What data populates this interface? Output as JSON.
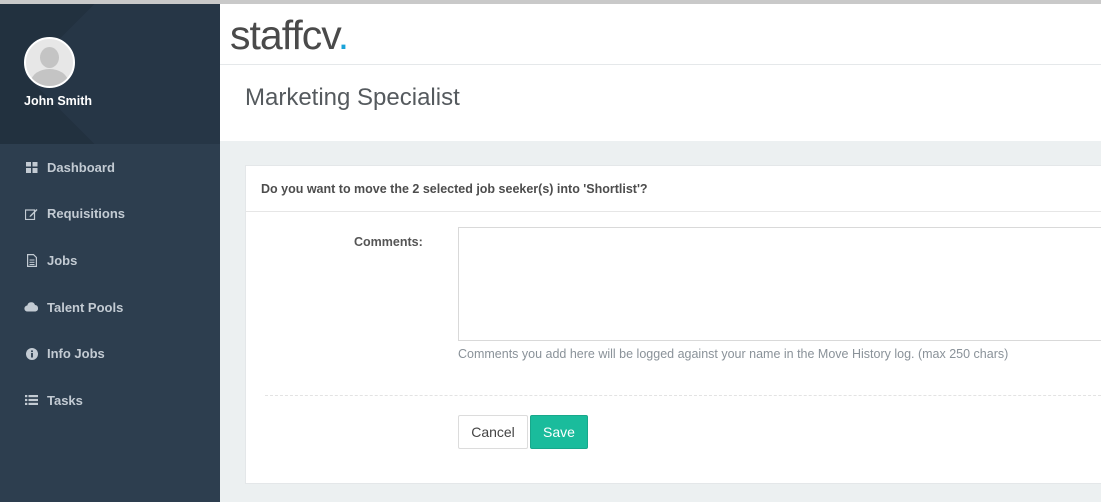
{
  "user": {
    "name": "John Smith"
  },
  "sidebar": {
    "items": [
      {
        "label": "Dashboard",
        "icon": "dashboard-icon"
      },
      {
        "label": "Requisitions",
        "icon": "edit-icon"
      },
      {
        "label": "Jobs",
        "icon": "document-icon"
      },
      {
        "label": "Talent Pools",
        "icon": "cloud-icon"
      },
      {
        "label": "Info Jobs",
        "icon": "info-icon"
      },
      {
        "label": "Tasks",
        "icon": "list-icon"
      }
    ]
  },
  "brand": {
    "logo_text": "staffcv",
    "logo_dot": ".",
    "accent": "#1aa3d9"
  },
  "page": {
    "title": "Marketing Specialist"
  },
  "form": {
    "question": "Do you want to move the 2 selected job seeker(s) into 'Shortlist'?",
    "comments_label": "Comments:",
    "comments_value": "",
    "help_text": "Comments you add here will be logged against your name in the Move History log. (max 250 chars)",
    "cancel_label": "Cancel",
    "save_label": "Save"
  },
  "colors": {
    "sidebar_bg": "#2d3e4f",
    "save_button": "#1abc9c"
  }
}
